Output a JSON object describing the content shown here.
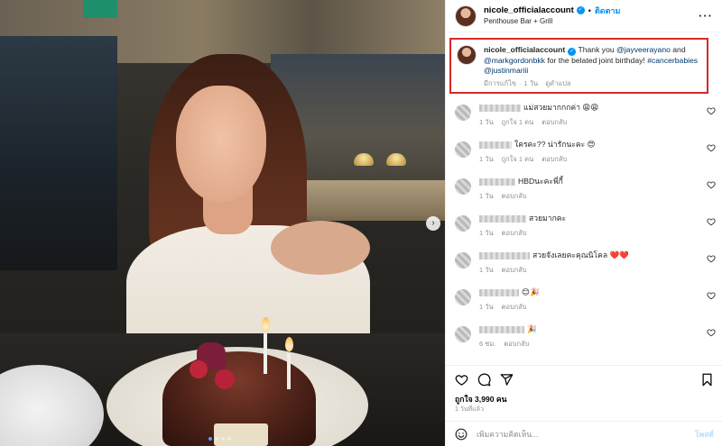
{
  "post": {
    "username": "nicole_officialaccount",
    "follow_label": "ติดตาม",
    "location": "Penthouse Bar + Grill",
    "more_label": "···"
  },
  "caption": {
    "username": "nicole_officialaccount",
    "text_1": "Thank you",
    "mention_1": "@jayveerayano",
    "text_2": "and",
    "mention_2": "@markgordonbkk",
    "text_3": "for the belated joint birthday!",
    "hashtag": "#cancerbabies",
    "mention_3": "@justinmariii",
    "edited": "มีการแก้ไข",
    "age": "1 วัน",
    "translate": "ดูคำแปล"
  },
  "comments": [
    {
      "text": "แม่สวยมากกกค่า 😩😩",
      "age": "1 วัน",
      "likes": "ถูกใจ 1 คน",
      "reply": "ตอบกลับ"
    },
    {
      "text": "ใครคะ?? น่ารักนะคะ 😍",
      "age": "1 วัน",
      "likes": "ถูกใจ 1 คน",
      "reply": "ตอบกลับ"
    },
    {
      "text": "HBDนะคะพี่กี้",
      "age": "1 วัน",
      "likes": "",
      "reply": "ตอบกลับ"
    },
    {
      "text": "สวยมากคะ",
      "age": "1 วัน",
      "likes": "",
      "reply": "ตอบกลับ"
    },
    {
      "text": "สวยจังเลยคะคุณนิโคล ❤️❤️",
      "age": "1 วัน",
      "likes": "",
      "reply": "ตอบกลับ"
    },
    {
      "text": "😊🎉",
      "age": "1 วัน",
      "likes": "",
      "reply": "ตอบกลับ"
    },
    {
      "text": "🎉",
      "age": "6 ชม.",
      "likes": "",
      "reply": "ตอบกลับ"
    }
  ],
  "actions": {
    "likes": "ถูกใจ 3,990 คน",
    "posted": "1 วันที่แล้ว"
  },
  "add_comment": {
    "placeholder": "เพิ่มความคิดเห็น...",
    "post_label": "โพสต์"
  },
  "icons": {
    "heart": "heart-icon",
    "comment": "comment-icon",
    "share": "share-icon",
    "bookmark": "bookmark-icon",
    "emoji": "emoji-icon",
    "verified": "verified-badge-icon",
    "next": "chevron-right-icon"
  },
  "colors": {
    "accent": "#0095f6",
    "highlight_border": "#d62828",
    "tag": "#00376b",
    "meta": "#8e8e8e"
  }
}
